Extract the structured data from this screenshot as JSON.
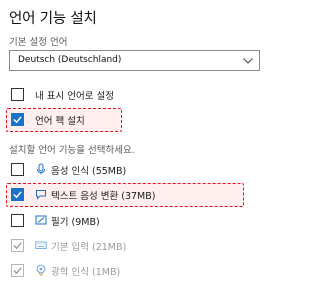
{
  "title": "언어 기능 설치",
  "default_lang": {
    "label": "기본 설정 언어",
    "value": "Deutsch (Deutschland)"
  },
  "options": {
    "display_lang": {
      "label": "내 표시 언어로 설정",
      "checked": false
    },
    "lang_pack": {
      "label": "언어 팩 설치",
      "checked": true
    }
  },
  "features_hint": "설치할 언어 기능을 선택하세요.",
  "features": [
    {
      "label": "음성 인식 (55MB)",
      "icon": "microphone-icon",
      "checked": false,
      "enabled": true
    },
    {
      "label": "텍스트 음성 변환 (37MB)",
      "icon": "speech-bubble-icon",
      "checked": true,
      "enabled": true
    },
    {
      "label": "필기 (9MB)",
      "icon": "pen-icon",
      "checked": false,
      "enabled": true
    },
    {
      "label": "기본 입력 (21MB)",
      "icon": "keyboard-icon",
      "checked": true,
      "enabled": false
    },
    {
      "label": "광학 인식 (1MB)",
      "icon": "ocr-eye-icon",
      "checked": true,
      "enabled": false
    }
  ],
  "colors": {
    "accent": "#1a73c9",
    "highlight": "#e0101f"
  }
}
